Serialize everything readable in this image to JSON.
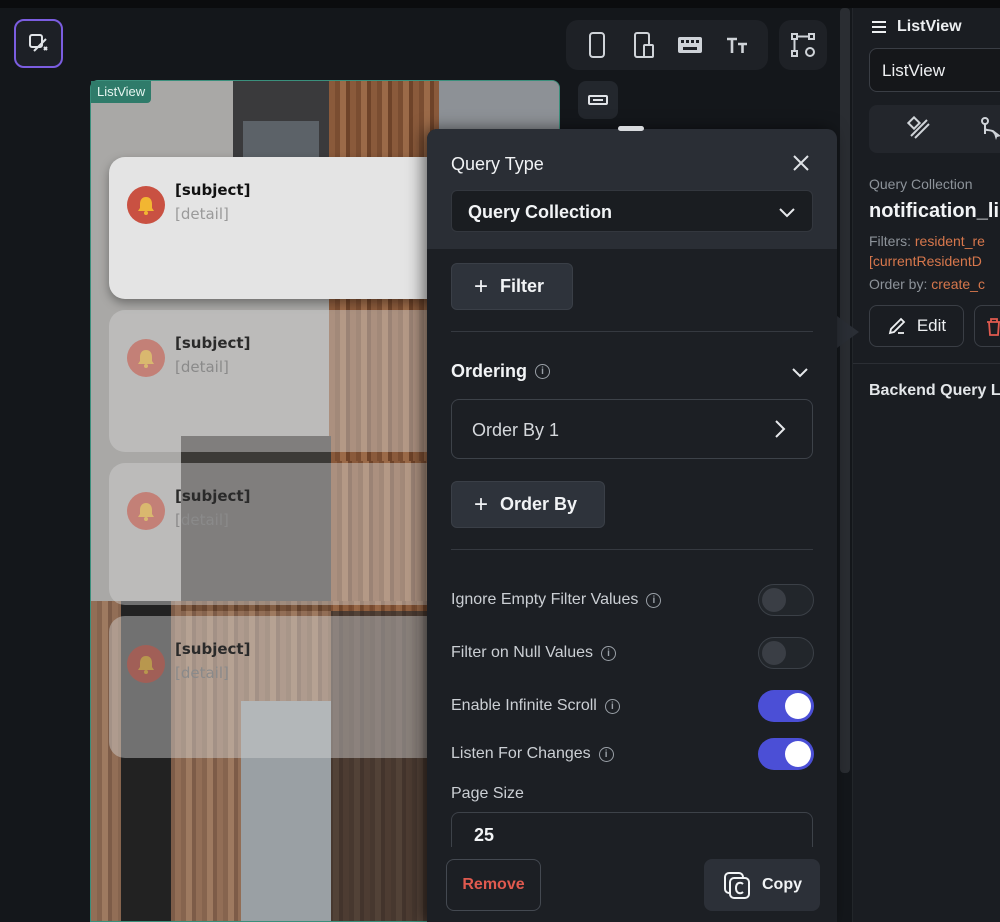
{
  "canvas": {
    "tag": "ListView",
    "cards": [
      {
        "subject": "[subject]",
        "detail": "[detail]"
      },
      {
        "subject": "[subject]",
        "detail": "[detail]"
      },
      {
        "subject": "[subject]",
        "detail": "[detail]"
      },
      {
        "subject": "[subject]",
        "detail": "[detail]"
      }
    ]
  },
  "toolbar": {
    "devices": [
      "phone-icon",
      "tablet-icon",
      "keyboard-icon",
      "text-size-icon"
    ],
    "graph": "graph-settings-icon"
  },
  "query_panel": {
    "title": "Query Type",
    "query_type_value": "Query Collection",
    "filter_button": "Filter",
    "ordering_label": "Ordering",
    "order_by_item": "Order By 1",
    "order_by_button": "Order By",
    "options": [
      {
        "label": "Ignore Empty Filter Values",
        "on": false
      },
      {
        "label": "Filter on Null Values",
        "on": false
      },
      {
        "label": "Enable Infinite Scroll",
        "on": true
      },
      {
        "label": "Listen For Changes",
        "on": true
      }
    ],
    "page_size_label": "Page Size",
    "page_size_value": "25",
    "remove_button": "Remove",
    "copy_button": "Copy"
  },
  "right_panel": {
    "header": "ListView",
    "name_value": "ListView",
    "query_label": "Query Collection",
    "collection": "notification_li",
    "filters_label": "Filters:",
    "filters_value": "resident_re",
    "filters_value2": "[currentResidentD",
    "order_label": "Order by:",
    "order_value": "create_c",
    "edit_button": "Edit",
    "backend_label": "Backend Query L"
  },
  "colors": {
    "accent": "#4b4fd6",
    "danger": "#e05a4f",
    "orange": "#d7774c",
    "teal": "#2f7b6a"
  }
}
